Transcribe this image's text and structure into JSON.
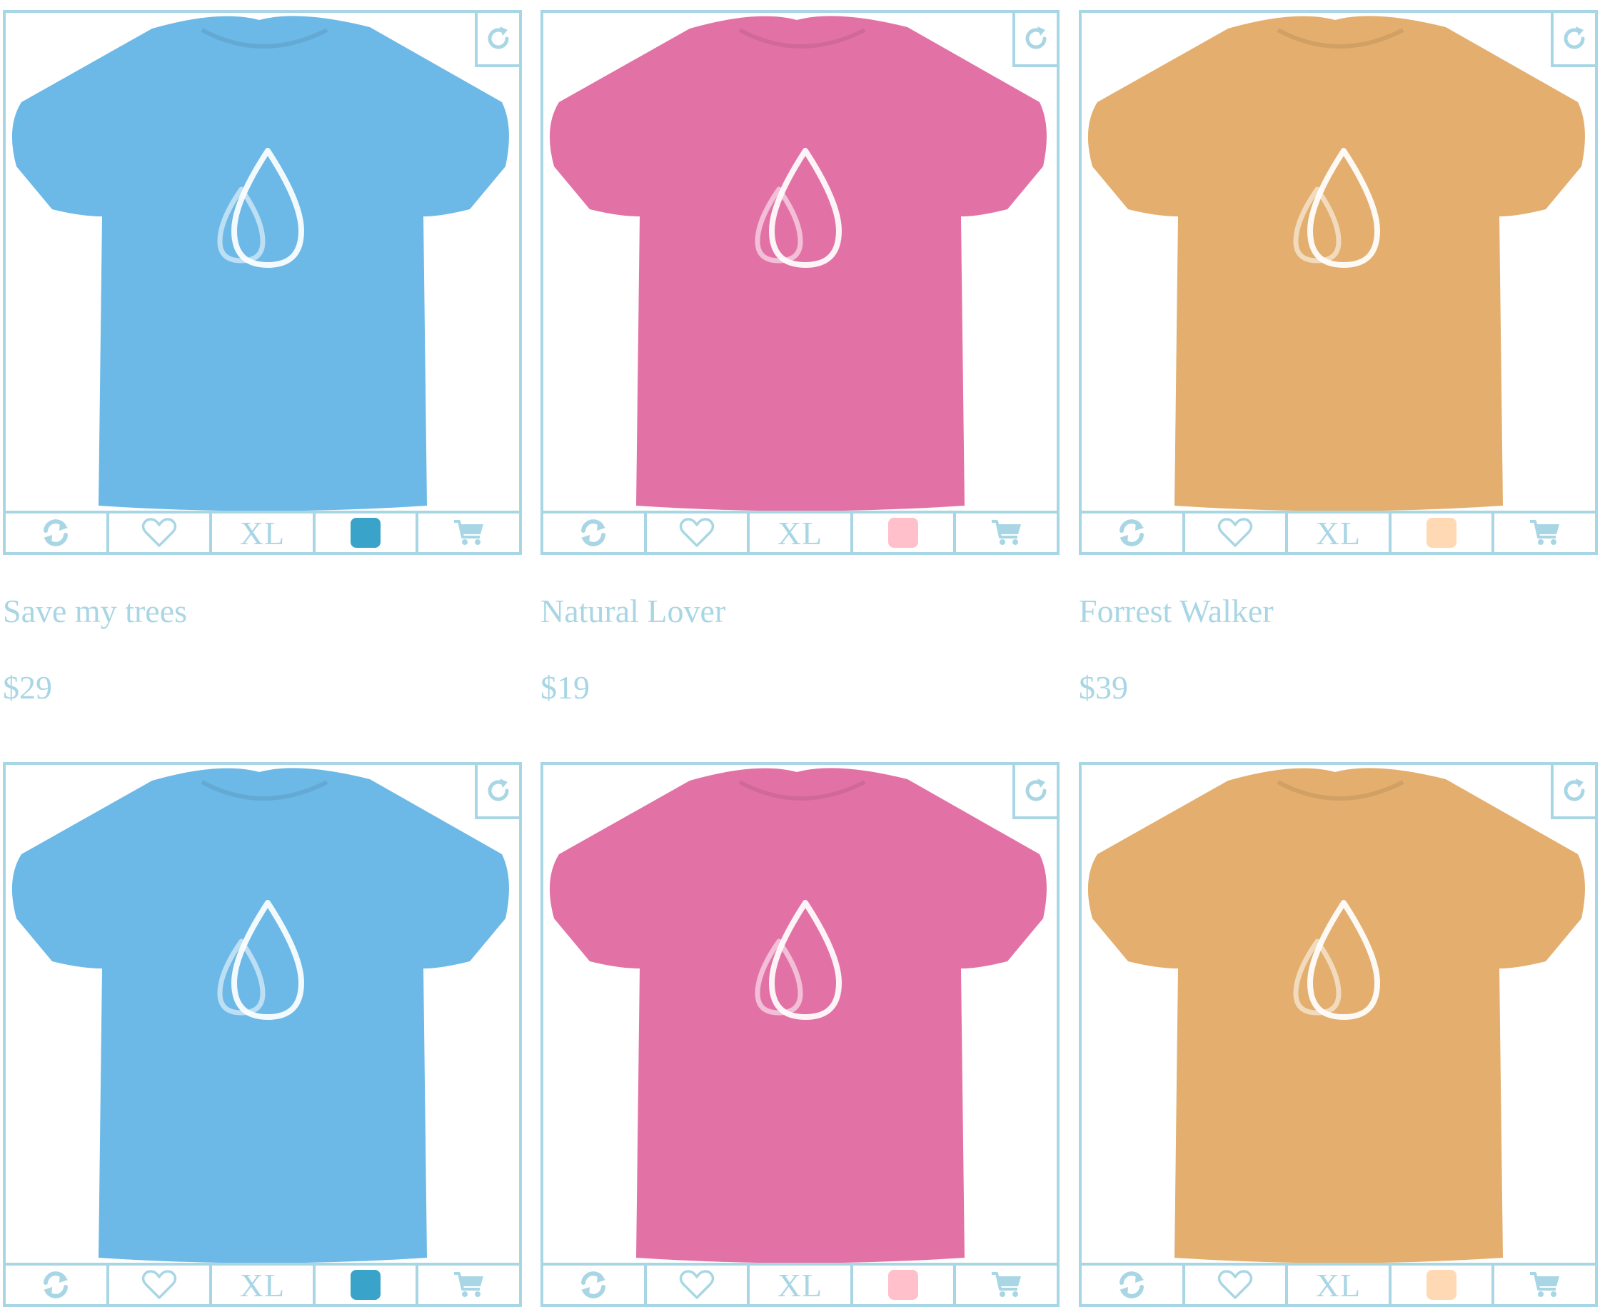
{
  "colors": {
    "accent": "#a9d6e4",
    "icon": "#a9d6e4"
  },
  "products": [
    {
      "title": "Save my trees",
      "price": "$29",
      "size": "XL",
      "shirt_color": "#6cb8e6",
      "swatch_color": "#3aa3c9"
    },
    {
      "title": "Natural Lover",
      "price": "$19",
      "size": "XL",
      "shirt_color": "#e272a6",
      "swatch_color": "#ffc0cb"
    },
    {
      "title": "Forrest Walker",
      "price": "$39",
      "size": "XL",
      "shirt_color": "#e3ae6e",
      "swatch_color": "#ffd9b3"
    },
    {
      "title": "",
      "price": "",
      "size": "XL",
      "shirt_color": "#6cb8e6",
      "swatch_color": "#3aa3c9"
    },
    {
      "title": "",
      "price": "",
      "size": "XL",
      "shirt_color": "#e272a6",
      "swatch_color": "#ffc0cb"
    },
    {
      "title": "",
      "price": "",
      "size": "XL",
      "shirt_color": "#e3ae6e",
      "swatch_color": "#ffd9b3"
    }
  ],
  "icons": {
    "corner": "rotate-cw-icon",
    "swap": "refresh-icon",
    "favorite": "heart-icon",
    "cart": "cart-icon",
    "logo": "water-drop-logo"
  }
}
